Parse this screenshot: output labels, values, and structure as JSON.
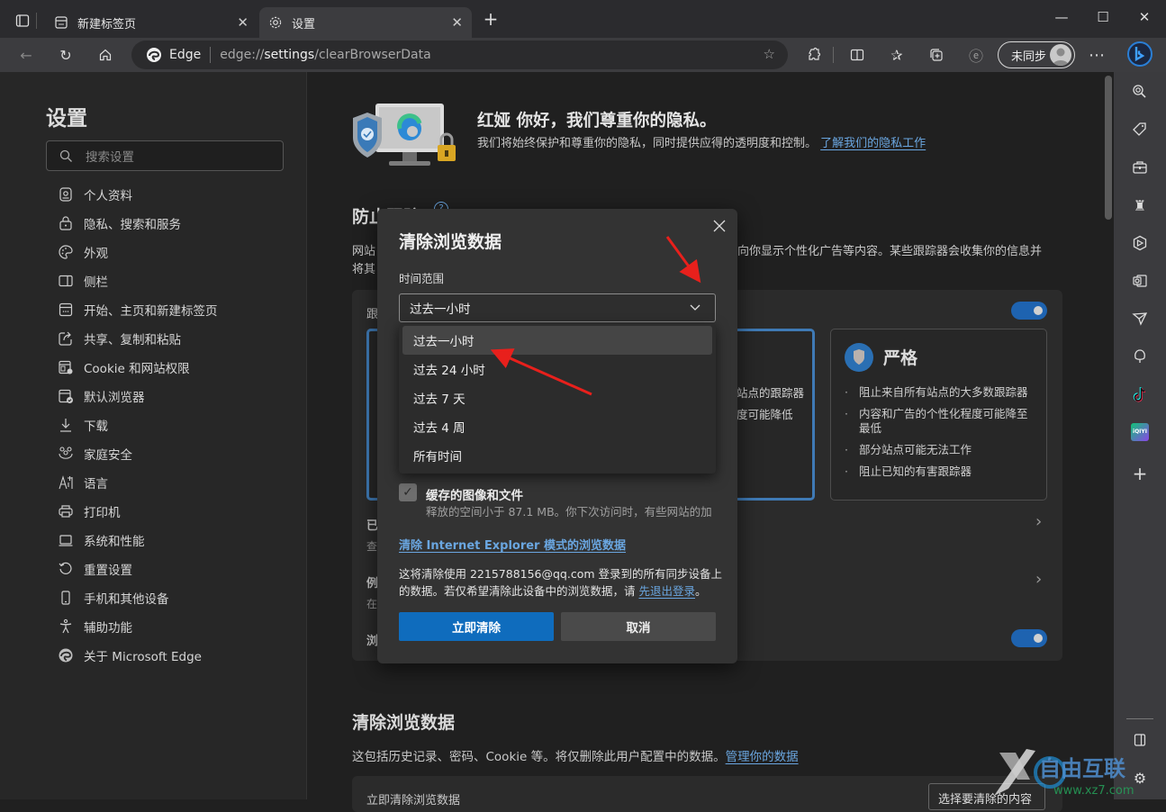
{
  "tabs": [
    {
      "label": "新建标签页",
      "icon": "new-tab-page-icon"
    },
    {
      "label": "设置",
      "icon": "gear-icon",
      "active": true
    }
  ],
  "window": {
    "minimize": "—",
    "maximize": "☐",
    "close": "✕",
    "new_tab": "+"
  },
  "address_bar": {
    "site_label": "Edge",
    "url_prefix": "edge://",
    "url_bold": "settings",
    "url_suffix": "/clearBrowserData"
  },
  "profile": {
    "label": "未同步"
  },
  "settings_nav": {
    "title": "设置",
    "search_placeholder": "搜索设置",
    "items": [
      {
        "label": "个人资料",
        "icon": "profile-icon"
      },
      {
        "label": "隐私、搜索和服务",
        "icon": "lock-icon"
      },
      {
        "label": "外观",
        "icon": "palette-icon"
      },
      {
        "label": "侧栏",
        "icon": "sidebar-icon"
      },
      {
        "label": "开始、主页和新建标签页",
        "icon": "home-page-icon"
      },
      {
        "label": "共享、复制和粘贴",
        "icon": "share-icon"
      },
      {
        "label": "Cookie 和网站权限",
        "icon": "cookie-icon"
      },
      {
        "label": "默认浏览器",
        "icon": "default-browser-icon"
      },
      {
        "label": "下载",
        "icon": "download-icon"
      },
      {
        "label": "家庭安全",
        "icon": "family-icon"
      },
      {
        "label": "语言",
        "icon": "language-icon"
      },
      {
        "label": "打印机",
        "icon": "printer-icon"
      },
      {
        "label": "系统和性能",
        "icon": "laptop-icon"
      },
      {
        "label": "重置设置",
        "icon": "reset-icon"
      },
      {
        "label": "手机和其他设备",
        "icon": "phone-icon"
      },
      {
        "label": "辅助功能",
        "icon": "accessibility-icon"
      },
      {
        "label": "关于 Microsoft Edge",
        "icon": "edge-icon"
      }
    ]
  },
  "main": {
    "hero": {
      "title": "红娅 你好，我们尊重你的隐私。",
      "desc": "我们将始终保护和尊重你的隐私，同时提供应得的透明度和控制。",
      "link": "了解我们的隐私工作"
    },
    "tracking": {
      "title": "防止跟踪",
      "desc_visible_left": "网站",
      "desc_visible_left2": "将其",
      "desc_visible_right": "向你显示个性化广告等内容。某些跟踪器会收集你的信息并",
      "row_label_partial": "跟",
      "balanced_partial_1": "站点的跟踪器",
      "balanced_partial_2": "度可能降低",
      "strict": {
        "title": "严格",
        "bullets": [
          "阻止来自所有站点的大多数跟踪器",
          "内容和广告的个性化程度可能降至最低",
          "部分站点可能无法工作",
          "阻止已知的有害跟踪器"
        ]
      },
      "blocked_row_partial": "已",
      "blocked_sub_partial": "查",
      "exceptions_row_partial": "例",
      "exceptions_sub_partial": "在",
      "strict_inprivate_partial": "浏"
    },
    "clear_section": {
      "title": "清除浏览数据",
      "desc": "这包括历史记录、密码、Cookie 等。将仅删除此用户配置中的数据。",
      "link": "管理你的数据",
      "row_partial": "立即清除浏览数据",
      "button_partial": "选择要清除的内容"
    }
  },
  "dialog": {
    "title": "清除浏览数据",
    "range_label": "时间范围",
    "selected": "过去一小时",
    "options": [
      "过去一小时",
      "过去 24 小时",
      "过去 7 天",
      "过去 4 周",
      "所有时间"
    ],
    "checkbox": {
      "label": "缓存的图像和文件",
      "sub": "释放的空间小于 87.1 MB。你下次访问时，有些网站的加",
      "checked": true
    },
    "ie_link": "清除 Internet Explorer 模式的浏览数据",
    "sync_text": "这将清除使用 2215788156@qq.com 登录到的所有同步设备上的数据。若仅希望清除此设备中的浏览数据，请 ",
    "sync_link": "先退出登录",
    "sync_end": "。",
    "clear_button": "立即清除",
    "cancel_button": "取消"
  },
  "right_sidebar": {
    "items": [
      "bing-icon",
      "search-icon",
      "tag-icon",
      "toolbox-icon",
      "games-icon",
      "office-icon",
      "outlook-icon",
      "send-icon",
      "tree-icon",
      "tiktok-icon",
      "iqiyi-icon",
      "add-icon"
    ]
  },
  "watermark": {
    "text": "自由互联",
    "url": "www.xz7.com"
  },
  "colors": {
    "accent": "#0f6cbd",
    "link": "#6aa6e0",
    "annotation": "#e8201c",
    "toggle": "#1e63b0"
  }
}
